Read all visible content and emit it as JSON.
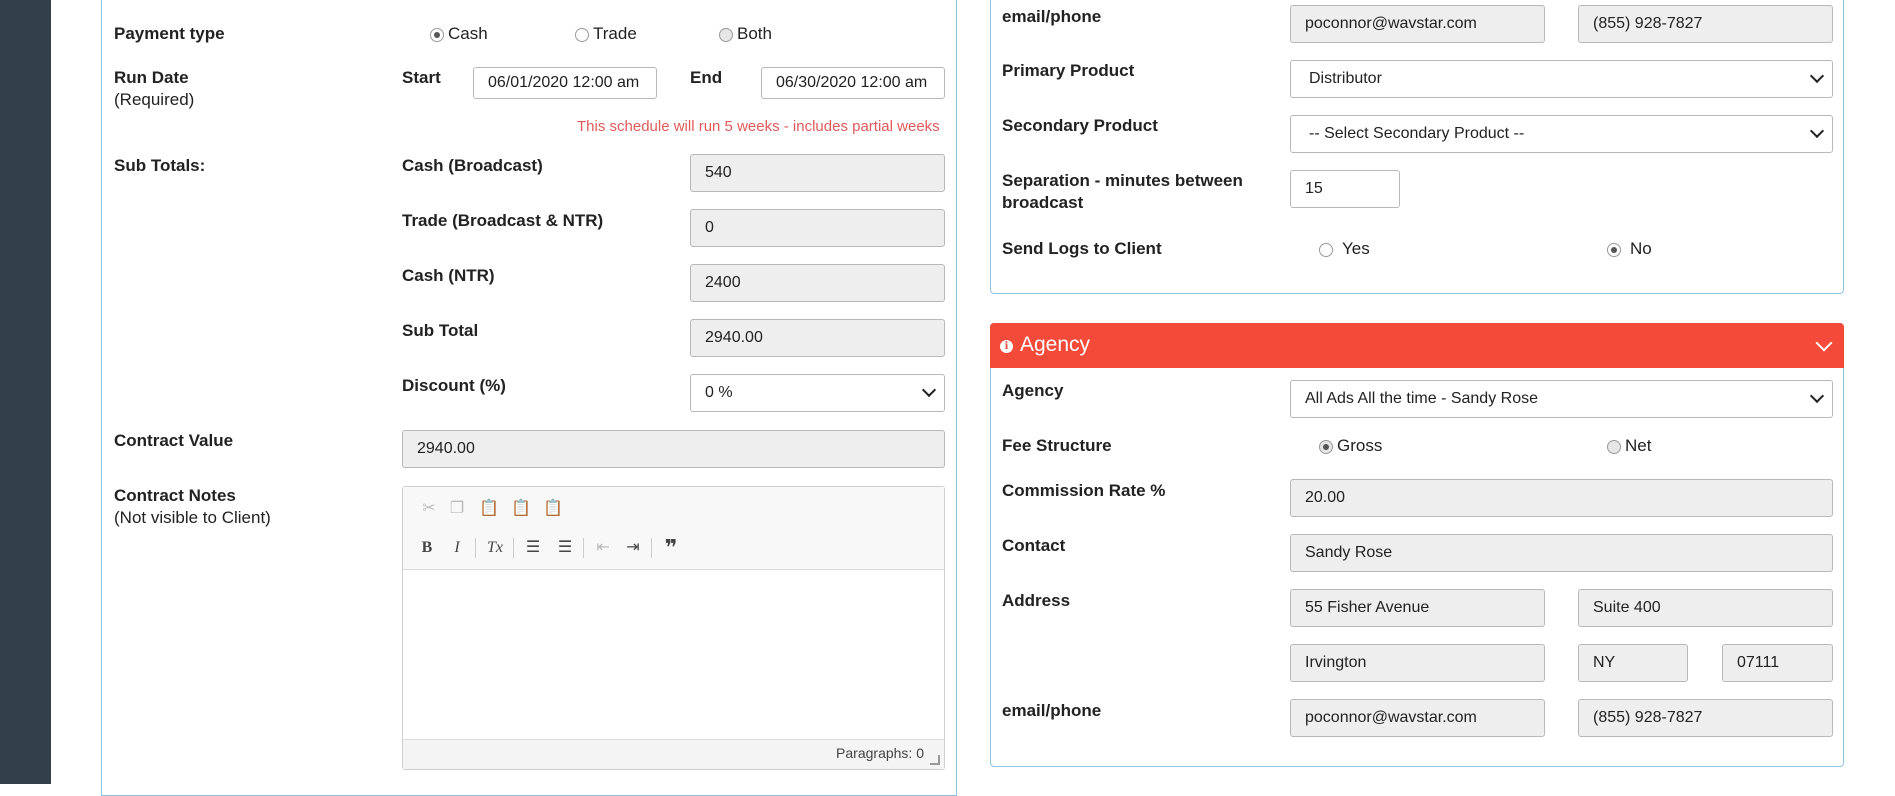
{
  "left": {
    "payment_type": {
      "label": "Payment type",
      "options": [
        "Cash",
        "Trade",
        "Both"
      ],
      "selected": "Cash"
    },
    "run_date": {
      "label": "Run Date",
      "sublabel": "(Required)",
      "start_label": "Start",
      "start_value": "06/01/2020 12:00 am",
      "end_label": "End",
      "end_value": "06/30/2020 12:00 am",
      "warning": "This schedule will run 5 weeks - includes partial weeks"
    },
    "sub_totals": {
      "label": "Sub Totals:",
      "cash_broadcast_label": "Cash (Broadcast)",
      "cash_broadcast_value": "540",
      "trade_label": "Trade (Broadcast & NTR)",
      "trade_value": "0",
      "cash_ntr_label": "Cash (NTR)",
      "cash_ntr_value": "2400",
      "subtotal_label": "Sub Total",
      "subtotal_value": "2940.00",
      "discount_label": "Discount (%)",
      "discount_value": "0 %"
    },
    "contract_value": {
      "label": "Contract Value",
      "value": "2940.00"
    },
    "contract_notes": {
      "label": "Contract Notes",
      "sublabel": "(Not visible to Client)",
      "paragraphs": "Paragraphs: 0"
    }
  },
  "right": {
    "email_phone_label": "email/phone",
    "email": "poconnor@wavstar.com",
    "phone": "(855) 928-7827",
    "primary_product_label": "Primary Product",
    "primary_product_value": "Distributor",
    "secondary_product_label": "Secondary Product",
    "secondary_product_value": "-- Select Secondary Product --",
    "separation_label_1": "Separation - minutes between",
    "separation_label_2": "broadcast",
    "separation_value": "15",
    "send_logs_label": "Send Logs to Client",
    "send_logs_yes": "Yes",
    "send_logs_no": "No",
    "send_logs_selected": "No"
  },
  "agency": {
    "title": "Agency",
    "agency_label": "Agency",
    "agency_value": "All Ads All the time - Sandy Rose",
    "fee_label": "Fee Structure",
    "fee_gross": "Gross",
    "fee_net": "Net",
    "fee_selected": "Gross",
    "commission_label": "Commission Rate %",
    "commission_value": "20.00",
    "contact_label": "Contact",
    "contact_value": "Sandy Rose",
    "address_label": "Address",
    "address1": "55 Fisher Avenue",
    "address2": "Suite 400",
    "city": "Irvington",
    "state": "NY",
    "zip": "07111",
    "email_phone_label": "email/phone",
    "email": "poconnor@wavstar.com",
    "phone": "(855) 928-7827"
  }
}
